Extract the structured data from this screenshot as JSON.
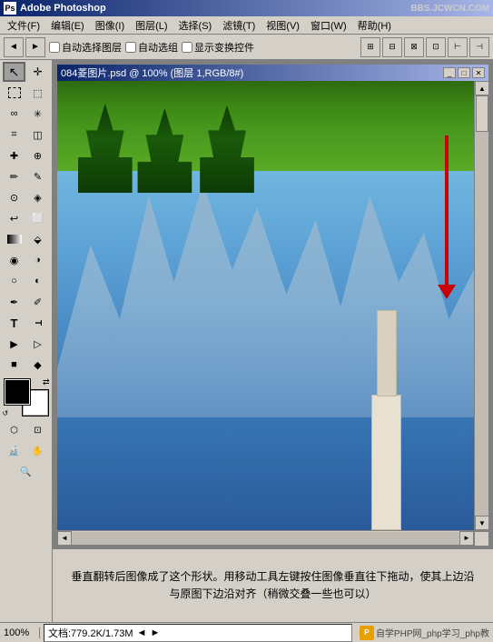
{
  "titlebar": {
    "title": "Adobe Photoshop",
    "watermark": "BBS.JCWCN.COM"
  },
  "menubar": {
    "items": [
      {
        "label": "文件(F)"
      },
      {
        "label": "编辑(E)"
      },
      {
        "label": "图像(I)"
      },
      {
        "label": "图层(L)"
      },
      {
        "label": "选择(S)"
      },
      {
        "label": "滤镜(T)"
      },
      {
        "label": "视图(V)"
      },
      {
        "label": "窗口(W)"
      },
      {
        "label": "帮助(H)"
      }
    ]
  },
  "optionsbar": {
    "auto_select_layer": "自动选择图层",
    "auto_select_group": "自动选组",
    "show_transform": "显示变换控件"
  },
  "document": {
    "title": "084菱图片.psd @ 100% (图层 1,RGB/8#)"
  },
  "description": {
    "text": "垂直翻转后图像成了这个形状。用移动工具左键按住图像垂直往下拖动，使其上边沿与原图下边沿对齐（稍微交叠一些也可以）"
  },
  "statusbar": {
    "zoom": "100%",
    "file_info": "文档:779.2K/1.73M",
    "nav_left": "◄",
    "nav_right": "►",
    "logo": "自学PHP网_php学习_php教"
  },
  "toolbar": {
    "tools": [
      {
        "id": "move",
        "label": "移动工具",
        "icon": "move-icon",
        "active": true
      },
      {
        "id": "select-rect",
        "label": "矩形选框",
        "icon": "select-rect-icon",
        "active": false
      },
      {
        "id": "select-ellipse",
        "label": "椭圆选框",
        "icon": "select-ellipse-icon",
        "active": false
      },
      {
        "id": "lasso",
        "label": "套索",
        "icon": "lasso-icon",
        "active": false
      },
      {
        "id": "magic-wand",
        "label": "魔术棒",
        "icon": "magic-wand-icon",
        "active": false
      },
      {
        "id": "crop",
        "label": "裁切",
        "icon": "crop-icon",
        "active": false
      },
      {
        "id": "slice",
        "label": "切片",
        "icon": "slice-icon",
        "active": false
      },
      {
        "id": "heal",
        "label": "修复",
        "icon": "heal-icon",
        "active": false
      },
      {
        "id": "brush",
        "label": "画笔",
        "icon": "brush-icon",
        "active": false
      },
      {
        "id": "stamp",
        "label": "图章",
        "icon": "stamp-icon",
        "active": false
      },
      {
        "id": "eraser",
        "label": "橡皮擦",
        "icon": "eraser-icon",
        "active": false
      },
      {
        "id": "gradient",
        "label": "渐变",
        "icon": "gradient-icon",
        "active": false
      },
      {
        "id": "blur",
        "label": "模糊",
        "icon": "blur-icon",
        "active": false
      },
      {
        "id": "dodge",
        "label": "减淡",
        "icon": "dodge-icon",
        "active": false
      },
      {
        "id": "pen",
        "label": "钢笔",
        "icon": "pen-icon",
        "active": false
      },
      {
        "id": "text",
        "label": "文字",
        "icon": "text-icon",
        "active": false
      },
      {
        "id": "path-select",
        "label": "路径选择",
        "icon": "path-select-icon",
        "active": false
      },
      {
        "id": "shape",
        "label": "形状",
        "icon": "shape-icon",
        "active": false
      },
      {
        "id": "eyedrop",
        "label": "吸管",
        "icon": "eyedrop-icon",
        "active": false
      },
      {
        "id": "hand",
        "label": "抓手",
        "icon": "hand-icon",
        "active": false
      },
      {
        "id": "zoom",
        "label": "缩放",
        "icon": "zoom-icon",
        "active": false
      }
    ]
  },
  "colors": {
    "titlebar_start": "#0a246a",
    "titlebar_end": "#a6b5e7",
    "background": "#d4d0c8",
    "accent": "#cc0000"
  }
}
